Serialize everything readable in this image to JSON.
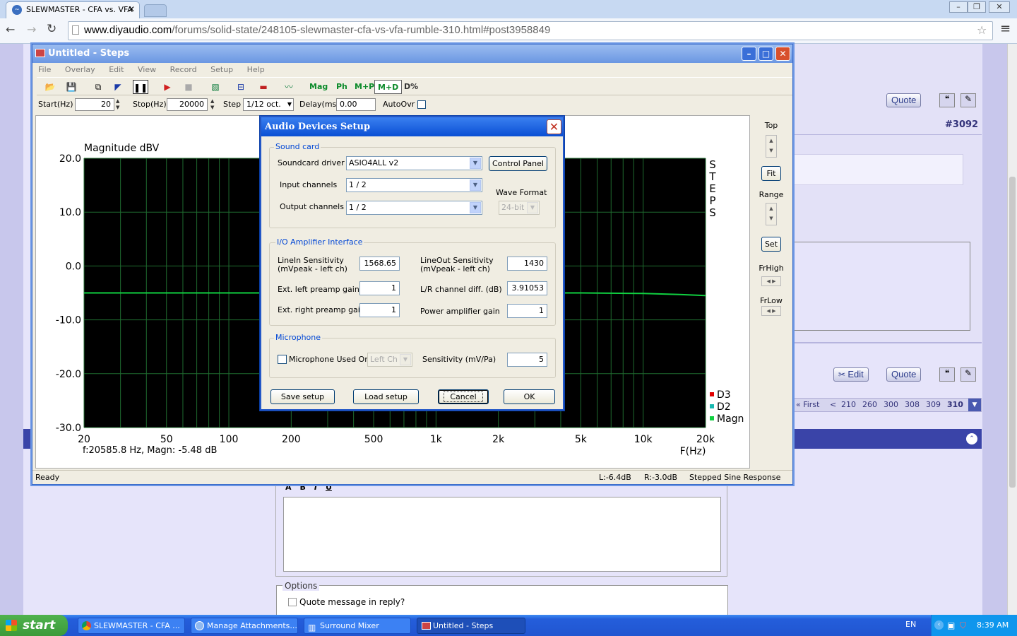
{
  "browser": {
    "tab_title": "SLEWMASTER - CFA vs. VFA",
    "url_host": "www.diyaudio.com",
    "url_path": "/forums/solid-state/248105-slewmaster-cfa-vs-vfa-rumble-310.html#post3958849"
  },
  "forum": {
    "post_number": "#3092",
    "quote_label": "Quote",
    "edit_label": "Edit",
    "pagination": [
      "« First",
      "<",
      "210",
      "260",
      "300",
      "308",
      "309",
      "310"
    ],
    "options_label": "Options",
    "quote_message_label": "Quote message in reply?"
  },
  "steps": {
    "title": "Untitled - Steps",
    "menu": [
      "File",
      "Overlay",
      "Edit",
      "View",
      "Record",
      "Setup",
      "Help"
    ],
    "toolbar_text": [
      "Mag",
      "Ph",
      "M+P",
      "M+D",
      "D%"
    ],
    "start_label": "Start(Hz)",
    "start_value": "20",
    "stop_label": "Stop(Hz)",
    "stop_value": "20000",
    "step_label": "Step",
    "step_value": "1/12 oct.",
    "delay_label": "Delay(ms)",
    "delay_value": "0.00",
    "autoovr_label": "AutoOvr",
    "plot_title": "Magnitude dBV",
    "y_ticks": [
      "20.0",
      "10.0",
      "0.0",
      "-10.0",
      "-20.0",
      "-30.0"
    ],
    "x_ticks": [
      "20",
      "50",
      "100",
      "200",
      "500",
      "1k",
      "2k",
      "5k",
      "10k",
      "20k"
    ],
    "x_axis_label": "F(Hz)",
    "steps_vertical": [
      "S",
      "T",
      "E",
      "P",
      "S"
    ],
    "legend": [
      {
        "name": "D3",
        "color": "#e00000"
      },
      {
        "name": "D2",
        "color": "#18b8b0"
      },
      {
        "name": "Magn",
        "color": "#10d040"
      }
    ],
    "cursor_readout": "f:20585.8 Hz, Magn: -5.48 dB",
    "right_panel": {
      "top_label": "Top",
      "fit_label": "Fit",
      "range_label": "Range",
      "set_label": "Set",
      "frhigh_label": "FrHigh",
      "frlow_label": "FrLow"
    },
    "status": {
      "ready": "Ready",
      "left_level": "L:-6.4dB",
      "right_level": "R:-3.0dB",
      "mode": "Stepped Sine Response"
    }
  },
  "chart_data": {
    "type": "line",
    "title": "Magnitude dBV",
    "xlabel": "F(Hz)",
    "ylabel": "",
    "x_scale": "log",
    "xlim": [
      20,
      20000
    ],
    "ylim": [
      -30,
      20
    ],
    "grid": true,
    "legend_position": "bottom-right",
    "series": [
      {
        "name": "Magn",
        "x": [
          20,
          100,
          1000,
          5000,
          10000,
          15000,
          20000
        ],
        "y": [
          -5.0,
          -5.0,
          -5.0,
          -5.0,
          -5.1,
          -5.3,
          -5.48
        ]
      }
    ]
  },
  "dialog": {
    "title": "Audio Devices Setup",
    "sound_card_group": "Sound card",
    "soundcard_driver_label": "Soundcard driver",
    "soundcard_driver_value": "ASIO4ALL v2",
    "control_panel_label": "Control Panel",
    "input_channels_label": "Input channels",
    "input_channels_value": "1 / 2",
    "output_channels_label": "Output channels",
    "output_channels_value": "1 / 2",
    "wave_format_label": "Wave Format",
    "wave_format_value": "24-bit",
    "io_group": "I/O Amplifier Interface",
    "linein_label_1": "LineIn Sensitivity",
    "linein_label_2": "(mVpeak - left ch)",
    "linein_value": "1568.65",
    "lineout_label_1": "LineOut Sensitivity",
    "lineout_label_2": "(mVpeak - left ch)",
    "lineout_value": "1430",
    "ext_left_label": "Ext. left preamp gain",
    "ext_left_value": "1",
    "lr_diff_label": "L/R channel diff. (dB)",
    "lr_diff_value": "3.91053",
    "ext_right_label": "Ext. right preamp gain",
    "ext_right_value": "1",
    "power_amp_label": "Power amplifier gain",
    "power_amp_value": "1",
    "mic_group": "Microphone",
    "mic_used_label": "Microphone Used On",
    "mic_channel_value": "Left Ch",
    "mic_sens_label": "Sensitivity (mV/Pa)",
    "mic_sens_value": "5",
    "save_label": "Save setup",
    "load_label": "Load setup",
    "cancel_label": "Cancel",
    "ok_label": "OK"
  },
  "taskbar": {
    "start_label": "start",
    "tasks": [
      "SLEWMASTER - CFA ...",
      "Manage Attachments...",
      "Surround Mixer",
      "Untitled - Steps"
    ],
    "lang": "EN",
    "clock": "8:39 AM"
  }
}
